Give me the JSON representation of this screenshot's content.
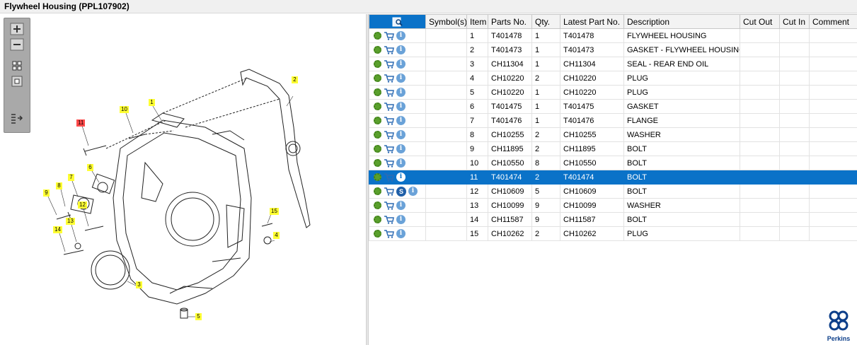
{
  "window": {
    "title": "Flywheel Housing (PPL107902)"
  },
  "toolbox": {
    "buttons": [
      "zoom-in",
      "zoom-out",
      "fit-all",
      "fit-window",
      "list-view"
    ]
  },
  "diagram": {
    "callouts": [
      {
        "label": "1"
      },
      {
        "label": "2"
      },
      {
        "label": "3"
      },
      {
        "label": "4"
      },
      {
        "label": "5"
      },
      {
        "label": "6"
      },
      {
        "label": "7"
      },
      {
        "label": "8"
      },
      {
        "label": "9"
      },
      {
        "label": "10"
      },
      {
        "label": "11",
        "selected": true
      },
      {
        "label": "12"
      },
      {
        "label": "13"
      },
      {
        "label": "14"
      },
      {
        "label": "15"
      }
    ]
  },
  "table": {
    "columns": [
      "",
      "Symbol(s)",
      "Item",
      "Parts No.",
      "Qty.",
      "Latest Part No.",
      "Description",
      "Cut Out",
      "Cut In",
      "Comment"
    ],
    "rows": [
      {
        "item": "1",
        "part": "T401478",
        "qty": "1",
        "latest": "T401478",
        "desc": "FLYWHEEL HOUSING"
      },
      {
        "item": "2",
        "part": "T401473",
        "qty": "1",
        "latest": "T401473",
        "desc": "GASKET - FLYWHEEL HOUSING"
      },
      {
        "item": "3",
        "part": "CH11304",
        "qty": "1",
        "latest": "CH11304",
        "desc": "SEAL - REAR END OIL"
      },
      {
        "item": "4",
        "part": "CH10220",
        "qty": "2",
        "latest": "CH10220",
        "desc": "PLUG"
      },
      {
        "item": "5",
        "part": "CH10220",
        "qty": "1",
        "latest": "CH10220",
        "desc": "PLUG"
      },
      {
        "item": "6",
        "part": "T401475",
        "qty": "1",
        "latest": "T401475",
        "desc": "GASKET"
      },
      {
        "item": "7",
        "part": "T401476",
        "qty": "1",
        "latest": "T401476",
        "desc": "FLANGE"
      },
      {
        "item": "8",
        "part": "CH10255",
        "qty": "2",
        "latest": "CH10255",
        "desc": "WASHER"
      },
      {
        "item": "9",
        "part": "CH11895",
        "qty": "2",
        "latest": "CH11895",
        "desc": "BOLT"
      },
      {
        "item": "10",
        "part": "CH10550",
        "qty": "8",
        "latest": "CH10550",
        "desc": "BOLT"
      },
      {
        "item": "11",
        "part": "T401474",
        "qty": "2",
        "latest": "T401474",
        "desc": "BOLT",
        "selected": true
      },
      {
        "item": "12",
        "part": "CH10609",
        "qty": "5",
        "latest": "CH10609",
        "desc": "BOLT",
        "s_badge": "S"
      },
      {
        "item": "13",
        "part": "CH10099",
        "qty": "9",
        "latest": "CH10099",
        "desc": "WASHER"
      },
      {
        "item": "14",
        "part": "CH11587",
        "qty": "9",
        "latest": "CH11587",
        "desc": "BOLT"
      },
      {
        "item": "15",
        "part": "CH10262",
        "qty": "2",
        "latest": "CH10262",
        "desc": "PLUG"
      }
    ]
  },
  "brand": {
    "name": "Perkins",
    "color": "#0d3f8a"
  },
  "colors": {
    "selection": "#0a72c8",
    "callout": "#ffff33",
    "callout_selected": "#ff4a4a",
    "gear": "#5aa02c",
    "info": "#6aa2d8"
  }
}
